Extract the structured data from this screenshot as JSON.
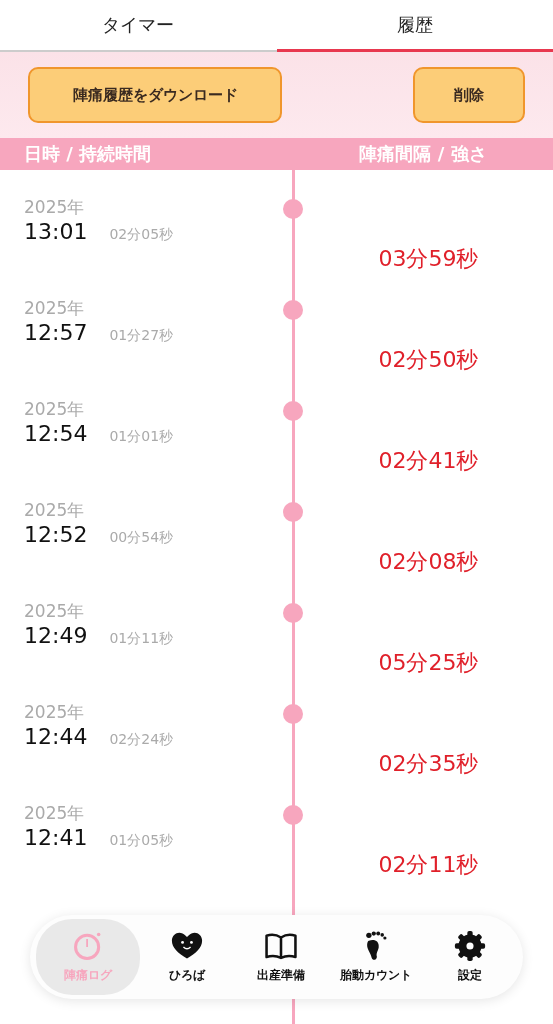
{
  "tabs": [
    {
      "label": "タイマー",
      "selected": false
    },
    {
      "label": "履歴",
      "selected": true
    }
  ],
  "actions": {
    "download": "陣痛履歴をダウンロード",
    "delete": "削除"
  },
  "columns": [
    "日時 / 持続時間",
    "陣痛間隔 / 強さ"
  ],
  "entries": [
    {
      "date": "2025年",
      "time": "13:01",
      "duration": "02分05秒",
      "interval": "03分59秒"
    },
    {
      "date": "2025年",
      "time": "12:57",
      "duration": "01分27秒",
      "interval": "02分50秒"
    },
    {
      "date": "2025年",
      "time": "12:54",
      "duration": "01分01秒",
      "interval": "02分41秒"
    },
    {
      "date": "2025年",
      "time": "12:52",
      "duration": "00分54秒",
      "interval": "02分08秒"
    },
    {
      "date": "2025年",
      "time": "12:49",
      "duration": "01分11秒",
      "interval": "05分25秒"
    },
    {
      "date": "2025年",
      "time": "12:44",
      "duration": "02分24秒",
      "interval": "02分35秒"
    },
    {
      "date": "2025年",
      "time": "12:41",
      "duration": "01分05秒",
      "interval": "02分11秒"
    }
  ],
  "nav": [
    {
      "label": "陣痛ログ",
      "kind": "timer",
      "selected": true
    },
    {
      "label": "ひろば",
      "kind": "heart",
      "selected": false
    },
    {
      "label": "出産準備",
      "kind": "book",
      "selected": false
    },
    {
      "label": "胎動カウント",
      "kind": "foot",
      "selected": false
    },
    {
      "label": "設定",
      "kind": "gear",
      "selected": false
    }
  ]
}
